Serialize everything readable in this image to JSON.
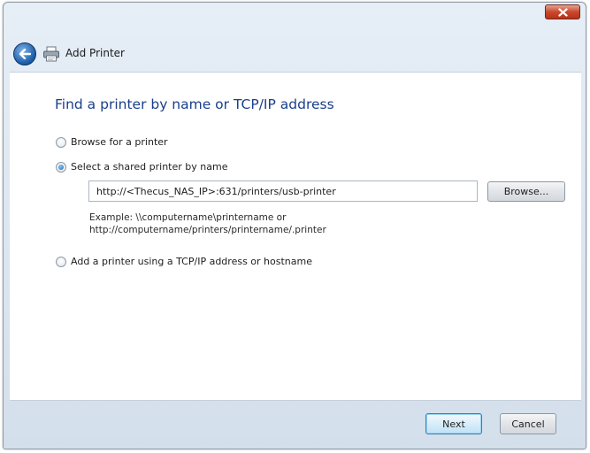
{
  "window": {
    "title": "Add Printer",
    "close_icon": "close-icon",
    "back_icon": "back-arrow-icon"
  },
  "main": {
    "heading": "Find a printer by name or TCP/IP address",
    "options": [
      {
        "label": "Browse for a printer",
        "selected": false
      },
      {
        "label": "Select a shared printer by name",
        "selected": true
      },
      {
        "label": "Add a printer using a TCP/IP address or hostname",
        "selected": false
      }
    ],
    "url_value": "http://<Thecus_NAS_IP>:631/printers/usb-printer",
    "browse_label": "Browse...",
    "example_line1": "Example: \\\\computername\\printername or",
    "example_line2": "http://computername/printers/printername/.printer"
  },
  "footer": {
    "next_label": "Next",
    "cancel_label": "Cancel"
  },
  "colors": {
    "heading": "#1a3f8a",
    "close_button": "#c9482e",
    "back_button": "#1f5faa"
  }
}
